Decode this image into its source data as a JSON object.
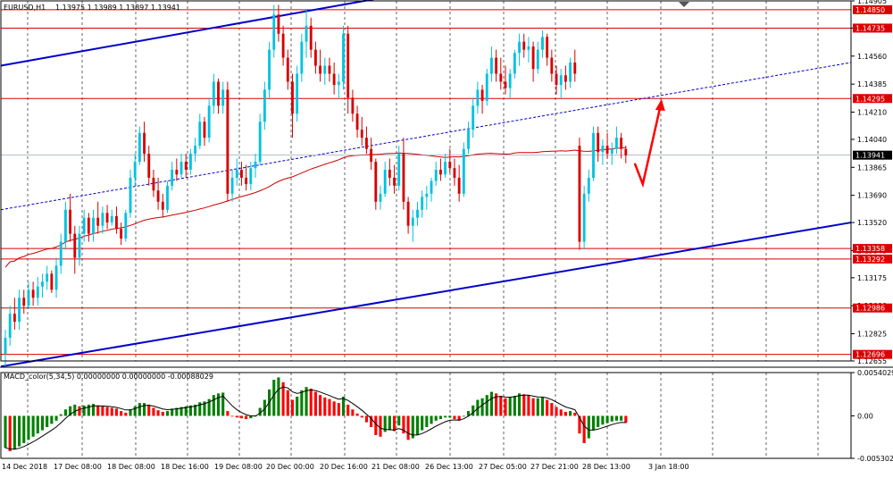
{
  "header": {
    "symbol_label": "EURUSD,H1",
    "ohlc_label": "1.13975 1.13989 1.13897 1.13941",
    "macd_label": "MACD_color(5,34,5) 0.00000000 0.00000000 -0.00088029"
  },
  "colors": {
    "bull": "#00c2e0",
    "bear": "#d60000",
    "channel": "#0000cc",
    "hline": "#dd0000",
    "ma": "#cc0000",
    "arrow": "#ff0000",
    "macd_pos": "#008000",
    "macd_neg": "#ff0000",
    "grid": "#000000"
  },
  "chart_data": [
    {
      "type": "candlestick",
      "symbol": "EURUSD",
      "timeframe": "H1",
      "last_price": "1.13941",
      "ylim": [
        1.12655,
        1.14905
      ],
      "price_ticks": [
        "1.14905",
        "1.14735",
        "1.14560",
        "1.14385",
        "1.14210",
        "1.14040",
        "1.13865",
        "1.13690",
        "1.13520",
        "1.13345",
        "1.13175",
        "1.13000",
        "1.12825",
        "1.12655"
      ],
      "time_labels": [
        "14 Dec 2018",
        "17 Dec 08:00",
        "18 Dec 08:00",
        "18 Dec 16:00",
        "19 Dec 08:00",
        "20 Dec 00:00",
        "20 Dec 16:00",
        "21 Dec 08:00",
        "26 Dec 13:00",
        "27 Dec 05:00",
        "27 Dec 21:00",
        "28 Dec 13:00",
        "3 Jan 18:00"
      ],
      "horizontal_levels": [
        {
          "label": "1.14850",
          "value": 1.1485
        },
        {
          "label": "1.14735",
          "value": 1.14735
        },
        {
          "label": "1.14295",
          "value": 1.14295
        },
        {
          "label": "1.13358",
          "value": 1.13358
        },
        {
          "label": "1.13292",
          "value": 1.13292
        },
        {
          "label": "1.12986",
          "value": 1.12986
        },
        {
          "label": "1.12696",
          "value": 1.12696
        }
      ],
      "candles": [
        [
          1.127,
          1.1285,
          1.1262,
          1.128
        ],
        [
          1.128,
          1.13,
          1.1275,
          1.1295
        ],
        [
          1.1295,
          1.1305,
          1.1285,
          1.129
        ],
        [
          1.129,
          1.131,
          1.1285,
          1.1305
        ],
        [
          1.1305,
          1.131,
          1.1295,
          1.13
        ],
        [
          1.13,
          1.1315,
          1.1298,
          1.131
        ],
        [
          1.131,
          1.1315,
          1.13,
          1.1305
        ],
        [
          1.1305,
          1.1318,
          1.13,
          1.1312
        ],
        [
          1.1312,
          1.132,
          1.1305,
          1.1315
        ],
        [
          1.1315,
          1.1325,
          1.131,
          1.132
        ],
        [
          1.132,
          1.1322,
          1.1308,
          1.131
        ],
        [
          1.131,
          1.133,
          1.1305,
          1.1325
        ],
        [
          1.1325,
          1.1345,
          1.132,
          1.134
        ],
        [
          1.134,
          1.1365,
          1.1335,
          1.136
        ],
        [
          1.136,
          1.137,
          1.134,
          1.1345
        ],
        [
          1.1345,
          1.135,
          1.132,
          1.133
        ],
        [
          1.133,
          1.135,
          1.1325,
          1.1345
        ],
        [
          1.1345,
          1.136,
          1.134,
          1.1355
        ],
        [
          1.1355,
          1.1358,
          1.134,
          1.1345
        ],
        [
          1.1345,
          1.136,
          1.134,
          1.1355
        ],
        [
          1.1355,
          1.1365,
          1.1345,
          1.135
        ],
        [
          1.135,
          1.1362,
          1.1345,
          1.1358
        ],
        [
          1.1358,
          1.1363,
          1.1348,
          1.1352
        ],
        [
          1.1352,
          1.136,
          1.135,
          1.1356
        ],
        [
          1.1356,
          1.1362,
          1.1345,
          1.1348
        ],
        [
          1.1348,
          1.1352,
          1.1338,
          1.1342
        ],
        [
          1.1342,
          1.136,
          1.134,
          1.1358
        ],
        [
          1.1358,
          1.1385,
          1.1355,
          1.138
        ],
        [
          1.138,
          1.1395,
          1.1375,
          1.139
        ],
        [
          1.139,
          1.1412,
          1.1388,
          1.1408
        ],
        [
          1.1408,
          1.1415,
          1.139,
          1.1395
        ],
        [
          1.1395,
          1.14,
          1.1375,
          1.138
        ],
        [
          1.138,
          1.1385,
          1.1368,
          1.1372
        ],
        [
          1.1372,
          1.138,
          1.136,
          1.1365
        ],
        [
          1.1365,
          1.137,
          1.1355,
          1.136
        ],
        [
          1.136,
          1.1378,
          1.1358,
          1.1375
        ],
        [
          1.1375,
          1.139,
          1.1372,
          1.1385
        ],
        [
          1.1385,
          1.1392,
          1.1378,
          1.1382
        ],
        [
          1.1382,
          1.1395,
          1.138,
          1.139
        ],
        [
          1.139,
          1.1395,
          1.138,
          1.1385
        ],
        [
          1.1385,
          1.1398,
          1.1382,
          1.1395
        ],
        [
          1.1395,
          1.1405,
          1.139,
          1.14
        ],
        [
          1.14,
          1.142,
          1.1398,
          1.1415
        ],
        [
          1.1415,
          1.1418,
          1.14,
          1.1405
        ],
        [
          1.1405,
          1.143,
          1.1402,
          1.1425
        ],
        [
          1.1425,
          1.1445,
          1.142,
          1.144
        ],
        [
          1.144,
          1.1442,
          1.142,
          1.1425
        ],
        [
          1.1425,
          1.144,
          1.142,
          1.1435
        ],
        [
          1.1435,
          1.144,
          1.1365,
          1.137
        ],
        [
          1.137,
          1.1385,
          1.1365,
          1.138
        ],
        [
          1.138,
          1.1392,
          1.1375,
          1.1385
        ],
        [
          1.1385,
          1.139,
          1.1375,
          1.138
        ],
        [
          1.138,
          1.1388,
          1.1372,
          1.1376
        ],
        [
          1.1376,
          1.139,
          1.1372,
          1.1386
        ],
        [
          1.1386,
          1.1395,
          1.138,
          1.139
        ],
        [
          1.139,
          1.142,
          1.1388,
          1.1415
        ],
        [
          1.1415,
          1.144,
          1.141,
          1.1435
        ],
        [
          1.1435,
          1.1465,
          1.143,
          1.146
        ],
        [
          1.146,
          1.1488,
          1.1455,
          1.1482
        ],
        [
          1.1482,
          1.1488,
          1.1465,
          1.147
        ],
        [
          1.147,
          1.1475,
          1.145,
          1.1455
        ],
        [
          1.1455,
          1.146,
          1.1435,
          1.144
        ],
        [
          1.144,
          1.1445,
          1.1405,
          1.142
        ],
        [
          1.142,
          1.145,
          1.1415,
          1.1445
        ],
        [
          1.1445,
          1.147,
          1.144,
          1.1465
        ],
        [
          1.1465,
          1.1485,
          1.1455,
          1.1475
        ],
        [
          1.1475,
          1.148,
          1.1455,
          1.146
        ],
        [
          1.146,
          1.1465,
          1.1445,
          1.145
        ],
        [
          1.145,
          1.146,
          1.144,
          1.1445
        ],
        [
          1.1445,
          1.1455,
          1.1438,
          1.145
        ],
        [
          1.145,
          1.1455,
          1.144,
          1.1445
        ],
        [
          1.1445,
          1.1452,
          1.1432,
          1.1438
        ],
        [
          1.1438,
          1.1445,
          1.143,
          1.144
        ],
        [
          1.144,
          1.1475,
          1.1435,
          1.147
        ],
        [
          1.147,
          1.1475,
          1.142,
          1.143
        ],
        [
          1.143,
          1.1435,
          1.1415,
          1.142
        ],
        [
          1.142,
          1.1425,
          1.1405,
          1.141
        ],
        [
          1.141,
          1.1418,
          1.14,
          1.1405
        ],
        [
          1.1405,
          1.1412,
          1.1395,
          1.1398
        ],
        [
          1.1398,
          1.1405,
          1.1385,
          1.139
        ],
        [
          1.139,
          1.1392,
          1.136,
          1.1365
        ],
        [
          1.1365,
          1.1375,
          1.136,
          1.137
        ],
        [
          1.137,
          1.139,
          1.1368,
          1.1385
        ],
        [
          1.1385,
          1.1392,
          1.1375,
          1.138
        ],
        [
          1.138,
          1.1388,
          1.137,
          1.1375
        ],
        [
          1.1375,
          1.14,
          1.1372,
          1.1395
        ],
        [
          1.1395,
          1.1405,
          1.136,
          1.1365
        ],
        [
          1.1365,
          1.1368,
          1.1345,
          1.135
        ],
        [
          1.135,
          1.136,
          1.134,
          1.1355
        ],
        [
          1.1355,
          1.1365,
          1.135,
          1.136
        ],
        [
          1.136,
          1.1372,
          1.1355,
          1.1368
        ],
        [
          1.1368,
          1.1375,
          1.136,
          1.137
        ],
        [
          1.137,
          1.138,
          1.1365,
          1.1378
        ],
        [
          1.1378,
          1.139,
          1.1375,
          1.1385
        ],
        [
          1.1385,
          1.1392,
          1.1378,
          1.1382
        ],
        [
          1.1382,
          1.1395,
          1.138,
          1.139
        ],
        [
          1.139,
          1.1398,
          1.1383,
          1.1386
        ],
        [
          1.1386,
          1.1392,
          1.1375,
          1.138
        ],
        [
          1.138,
          1.1388,
          1.1365,
          1.137
        ],
        [
          1.137,
          1.1402,
          1.1368,
          1.1398
        ],
        [
          1.1398,
          1.1415,
          1.1395,
          1.141
        ],
        [
          1.141,
          1.143,
          1.1405,
          1.1425
        ],
        [
          1.1425,
          1.144,
          1.142,
          1.1435
        ],
        [
          1.1435,
          1.1438,
          1.142,
          1.1428
        ],
        [
          1.1428,
          1.1448,
          1.1425,
          1.1445
        ],
        [
          1.1445,
          1.1462,
          1.144,
          1.1455
        ],
        [
          1.1455,
          1.146,
          1.144,
          1.1445
        ],
        [
          1.1445,
          1.1455,
          1.1435,
          1.144
        ],
        [
          1.144,
          1.145,
          1.1432,
          1.1436
        ],
        [
          1.1436,
          1.1448,
          1.143,
          1.1445
        ],
        [
          1.1445,
          1.146,
          1.1442,
          1.1458
        ],
        [
          1.1458,
          1.147,
          1.145,
          1.1465
        ],
        [
          1.1465,
          1.147,
          1.1455,
          1.146
        ],
        [
          1.146,
          1.1468,
          1.1452,
          1.1462
        ],
        [
          1.1462,
          1.1465,
          1.144,
          1.1448
        ],
        [
          1.1448,
          1.1465,
          1.1445,
          1.146
        ],
        [
          1.146,
          1.1472,
          1.1455,
          1.1468
        ],
        [
          1.1468,
          1.147,
          1.145,
          1.1455
        ],
        [
          1.1455,
          1.146,
          1.144,
          1.1445
        ],
        [
          1.1445,
          1.145,
          1.1432,
          1.1438
        ],
        [
          1.1438,
          1.1448,
          1.143,
          1.1444
        ],
        [
          1.1444,
          1.145,
          1.1435,
          1.144
        ],
        [
          1.144,
          1.1455,
          1.1436,
          1.1452
        ],
        [
          1.1452,
          1.146,
          1.144,
          1.1445
        ],
        [
          1.14,
          1.1405,
          1.1335,
          1.134
        ],
        [
          1.134,
          1.1375,
          1.1335,
          1.137
        ],
        [
          1.137,
          1.1385,
          1.1365,
          1.138
        ],
        [
          1.138,
          1.1412,
          1.1378,
          1.1408
        ],
        [
          1.1408,
          1.1412,
          1.139,
          1.1396
        ],
        [
          1.1396,
          1.1404,
          1.1388,
          1.14
        ],
        [
          1.14,
          1.1408,
          1.1392,
          1.1395
        ],
        [
          1.1395,
          1.1402,
          1.1388,
          1.1398
        ],
        [
          1.1398,
          1.1412,
          1.1395,
          1.1405
        ],
        [
          1.1405,
          1.1408,
          1.1392,
          1.1398
        ],
        [
          1.1398,
          1.14,
          1.1389,
          1.1394
        ]
      ]
    },
    {
      "type": "bar",
      "name": "MACD_color(5,34,5)",
      "ylim": [
        -0.005302,
        0.0054029
      ],
      "ticks": [
        "0.0054029",
        "0.00",
        "-0.0053020"
      ],
      "values": [
        -0.004,
        -0.0044,
        -0.0042,
        -0.0038,
        -0.0034,
        -0.003,
        -0.0026,
        -0.0022,
        -0.0018,
        -0.0014,
        -0.001,
        -0.0006,
        0.0002,
        0.0008,
        0.0012,
        0.0014,
        0.0012,
        0.0013,
        0.0014,
        0.0015,
        0.0013,
        0.0012,
        0.0011,
        0.001,
        0.0009,
        0.0006,
        0.0004,
        0.0008,
        0.0012,
        0.0016,
        0.0016,
        0.0014,
        0.001,
        0.0007,
        0.0005,
        0.0006,
        0.0009,
        0.001,
        0.0011,
        0.0012,
        0.0013,
        0.0014,
        0.0017,
        0.0018,
        0.0021,
        0.0026,
        0.0028,
        0.0029,
        0.0006,
        0.0,
        -0.0002,
        -0.0003,
        -0.0004,
        -0.0003,
        0.0,
        0.001,
        0.002,
        0.0033,
        0.0045,
        0.0048,
        0.0042,
        0.0032,
        0.002,
        0.0024,
        0.0032,
        0.0036,
        0.0034,
        0.003,
        0.0026,
        0.0023,
        0.0021,
        0.0018,
        0.0016,
        0.0024,
        0.0014,
        0.0008,
        0.0003,
        -0.0002,
        -0.0008,
        -0.0014,
        -0.0024,
        -0.0026,
        -0.002,
        -0.0018,
        -0.0019,
        -0.0012,
        -0.0022,
        -0.003,
        -0.0028,
        -0.0024,
        -0.0018,
        -0.0014,
        -0.001,
        -0.0006,
        -0.0004,
        -0.0002,
        -0.0002,
        -0.0004,
        -0.0006,
        0.0,
        0.0006,
        0.0013,
        0.002,
        0.0022,
        0.0026,
        0.003,
        0.0028,
        0.0025,
        0.0022,
        0.0023,
        0.0025,
        0.0028,
        0.0027,
        0.0026,
        0.0022,
        0.0022,
        0.0023,
        0.002,
        0.0016,
        0.0011,
        0.0008,
        0.0005,
        0.0006,
        0.0004,
        -0.0022,
        -0.0034,
        -0.0028,
        -0.0018,
        -0.0014,
        -0.0011,
        -0.0009,
        -0.0007,
        -0.0006,
        -0.0006,
        -0.00088
      ]
    }
  ]
}
